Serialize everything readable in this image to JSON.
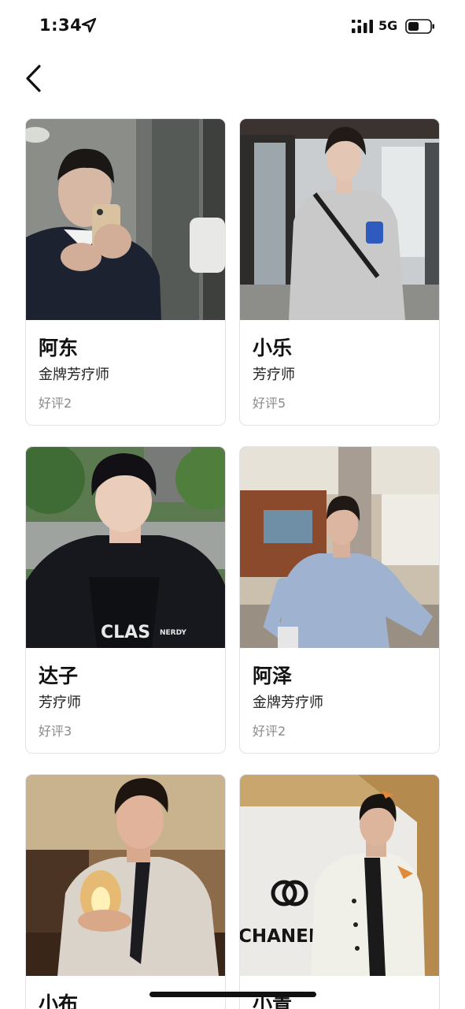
{
  "status_bar": {
    "time": "1:34",
    "network": "5G",
    "icons": [
      "location-arrow-icon",
      "signal-icon",
      "battery-icon"
    ]
  },
  "nav": {
    "back_icon": "chevron-left-icon"
  },
  "therapists": [
    {
      "name": "阿东",
      "title": "金牌芳疗师",
      "rating": "好评2",
      "photo": "man-mirror-selfie-suit-photo"
    },
    {
      "name": "小乐",
      "title": "芳疗师",
      "rating": "好评5",
      "photo": "man-grey-sweatshirt-photo"
    },
    {
      "name": "达子",
      "title": "芳疗师",
      "rating": "好评3",
      "photo": "man-black-puffer-jacket-photo"
    },
    {
      "name": "阿泽",
      "title": "金牌芳疗师",
      "rating": "好评2",
      "photo": "man-striped-shirt-cafe-photo"
    },
    {
      "name": "小布",
      "title": "",
      "rating": "",
      "photo": "man-shirt-tie-candle-photo"
    },
    {
      "name": "小青",
      "title": "",
      "rating": "",
      "photo": "man-white-jacket-chanel-wall-photo",
      "photo_text": "CHANEL"
    }
  ],
  "colors": {
    "background": "#ffffff",
    "card_border": "#e3e3e6",
    "rating_text": "#8a8a8e"
  }
}
